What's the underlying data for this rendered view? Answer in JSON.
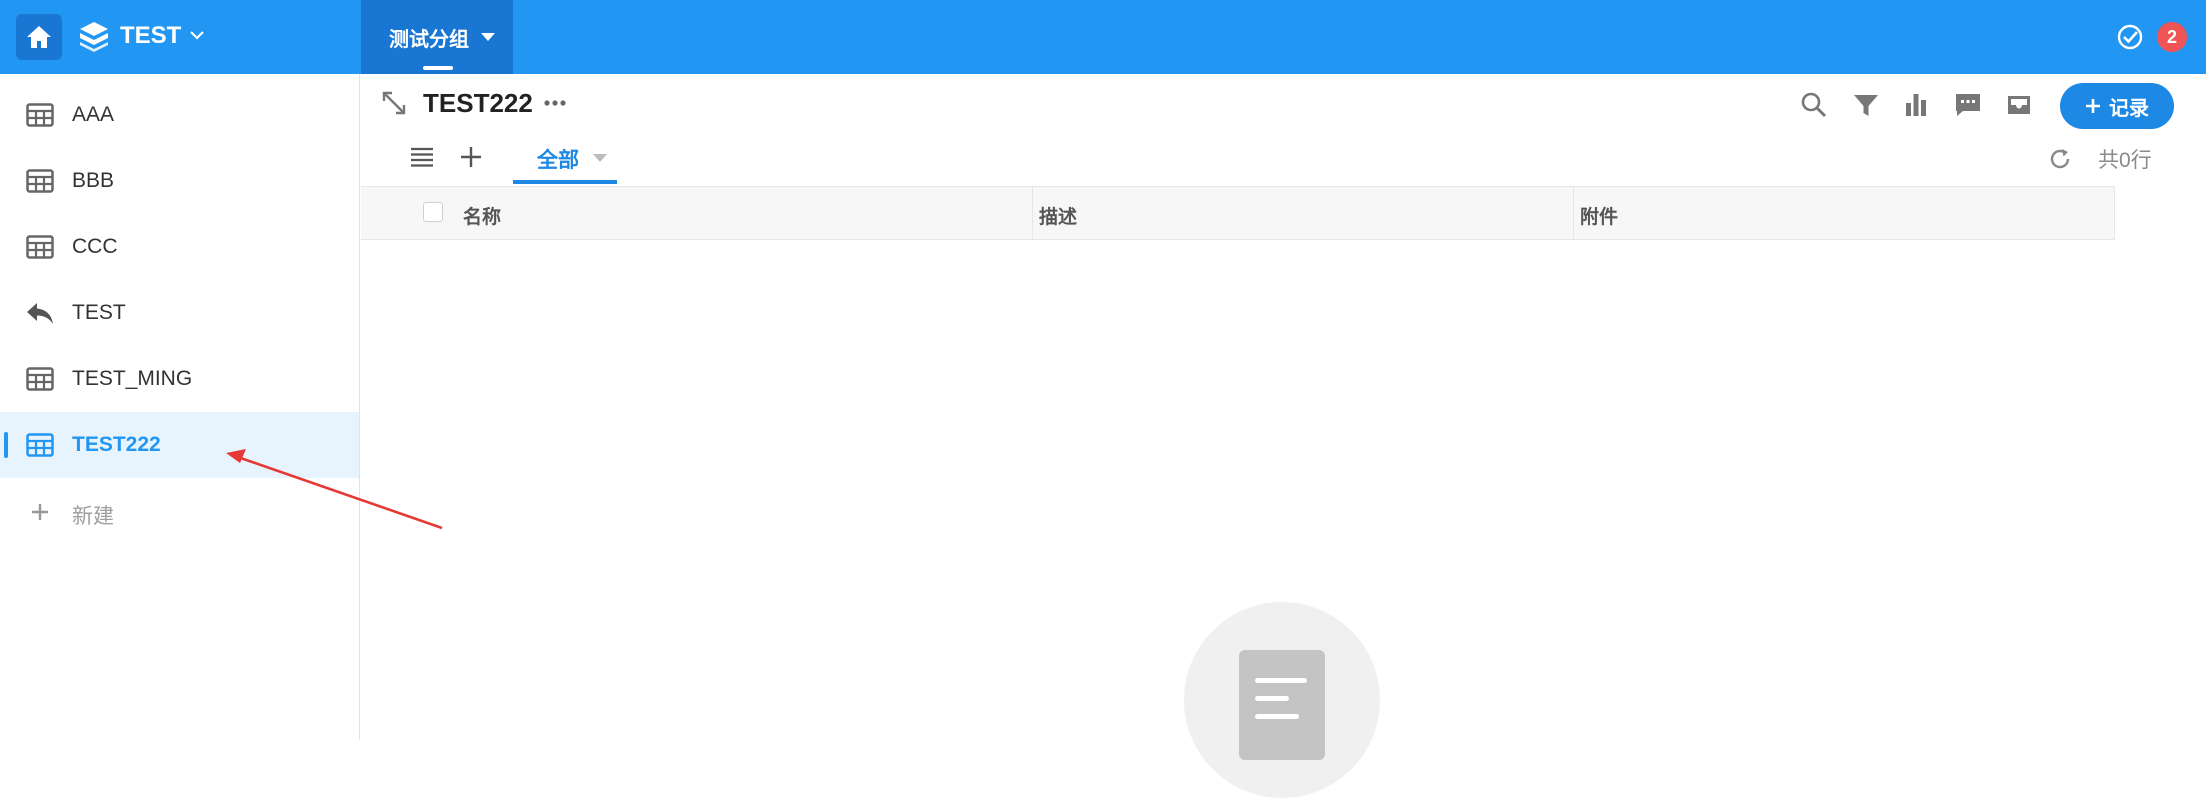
{
  "topbar": {
    "app_name": "TEST",
    "group_tab_label": "测试分组",
    "badge_count": "2",
    "colors": {
      "bar": "#2196f3",
      "active_tab": "#1976d2",
      "badge": "#f05454"
    }
  },
  "sidebar": {
    "items": [
      {
        "label": "AAA",
        "icon": "table-icon"
      },
      {
        "label": "BBB",
        "icon": "table-icon"
      },
      {
        "label": "CCC",
        "icon": "table-icon"
      },
      {
        "label": "TEST",
        "icon": "reply-icon"
      },
      {
        "label": "TEST_MING",
        "icon": "table-icon"
      },
      {
        "label": "TEST222",
        "icon": "table-icon",
        "active": true
      }
    ],
    "new_label": "新建"
  },
  "main": {
    "title": "TEST222",
    "add_record_label": "记录",
    "view_tab_label": "全部",
    "row_count": "共0行",
    "toolbar_icons": [
      "search-icon",
      "filter-icon",
      "chart-icon",
      "comment-icon",
      "inbox-icon"
    ]
  },
  "table": {
    "columns": [
      "名称",
      "描述",
      "附件"
    ],
    "rows": []
  }
}
